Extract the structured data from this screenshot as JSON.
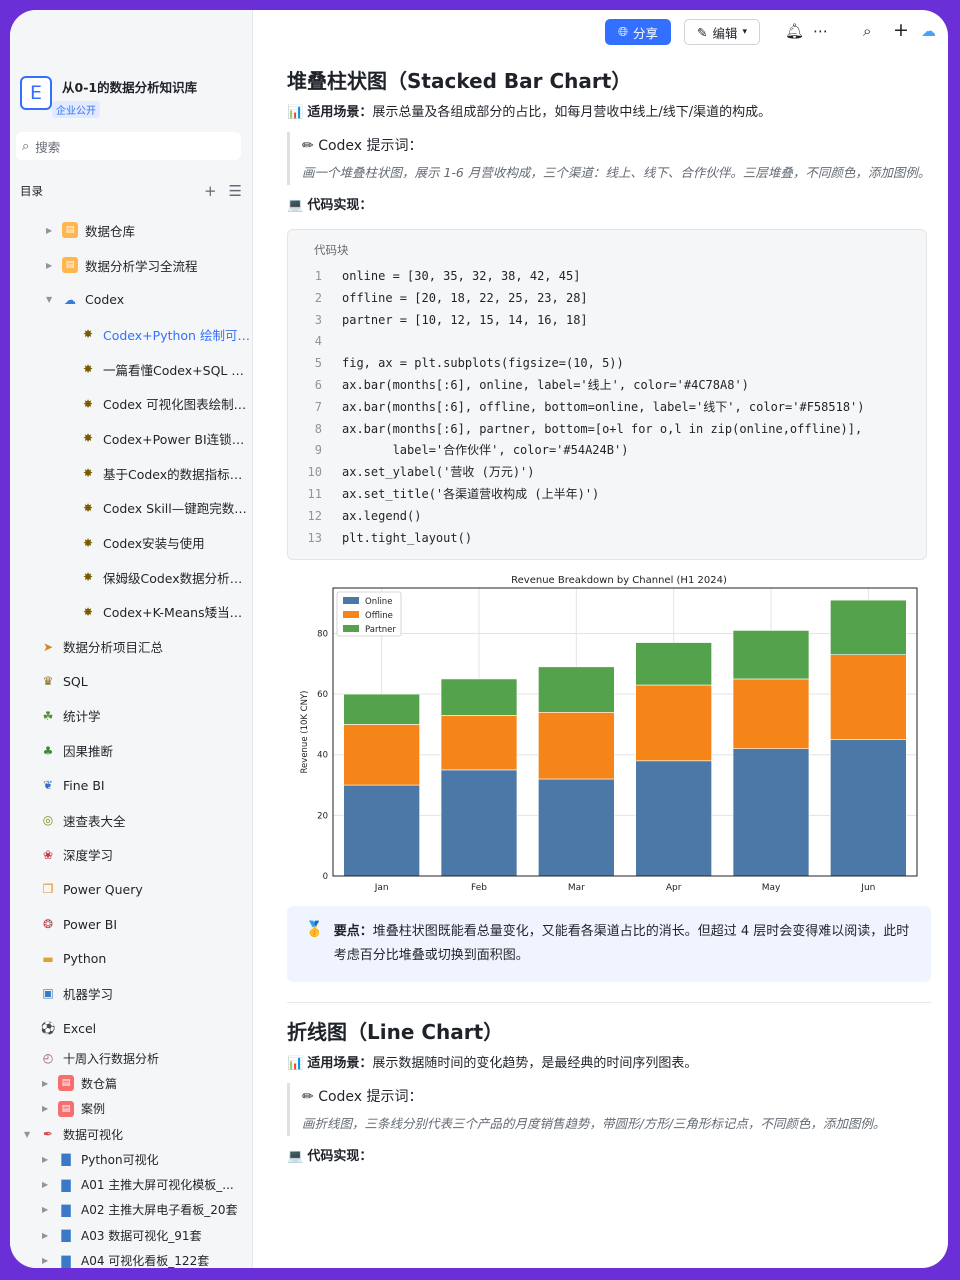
{
  "kb": {
    "logo_letter": "E",
    "title": "从0-1的数据分析知识库",
    "tag": "企业公开"
  },
  "search": {
    "placeholder": "搜索"
  },
  "toc_label": "目录",
  "toc": [
    {
      "label": "数据仓库",
      "icon": "folder-icon",
      "indent": 1,
      "arrow": "right"
    },
    {
      "label": "数据分析学习全流程",
      "icon": "folder-icon",
      "indent": 1,
      "arrow": "right"
    },
    {
      "label": "Codex",
      "icon": "codex-icon",
      "indent": 1,
      "arrow": "down"
    },
    {
      "label": "Codex+Python 绘制可视...",
      "icon": "sparkle-icon",
      "indent": 2,
      "active": true
    },
    {
      "label": "一篇看懂Codex+SQL 实操...",
      "icon": "sparkle-icon",
      "indent": 2
    },
    {
      "label": "Codex 可视化图表绘制全...",
      "icon": "sparkle-icon",
      "indent": 2
    },
    {
      "label": "Codex+Power BI连锁糕点...",
      "icon": "sparkle-icon",
      "indent": 2
    },
    {
      "label": "基于Codex的数据指标体...",
      "icon": "sparkle-icon",
      "indent": 2
    },
    {
      "label": "Codex Skill—键跑完数据...",
      "icon": "sparkle-icon",
      "indent": 2
    },
    {
      "label": "Codex安装与使用",
      "icon": "sparkle-icon",
      "indent": 2
    },
    {
      "label": "保姆级Codex数据分析技...",
      "icon": "sparkle-icon",
      "indent": 2
    },
    {
      "label": "Codex+K-Means矮当劳满...",
      "icon": "sparkle-icon",
      "indent": 2
    },
    {
      "label": "数据分析项目汇总",
      "icon": "rocket-icon",
      "indent": 0
    },
    {
      "label": "SQL",
      "icon": "crown-icon",
      "indent": 0
    },
    {
      "label": "统计学",
      "icon": "sprout-icon",
      "indent": 0
    },
    {
      "label": "因果推断",
      "icon": "tree-icon",
      "indent": 0
    },
    {
      "label": "Fine BI",
      "icon": "ribbon-icon",
      "indent": 0
    },
    {
      "label": "速查表大全",
      "icon": "snail-icon",
      "indent": 0
    },
    {
      "label": "深度学习",
      "icon": "butterfly-icon",
      "indent": 0
    },
    {
      "label": "Power Query",
      "icon": "gift-icon",
      "indent": 0
    },
    {
      "label": "Power BI",
      "icon": "medal-icon",
      "indent": 0
    },
    {
      "label": "Python",
      "icon": "box-icon",
      "indent": 0
    },
    {
      "label": "机器学习",
      "icon": "monitor-icon",
      "indent": 0
    },
    {
      "label": "Excel",
      "icon": "soccer-icon",
      "indent": 0
    },
    {
      "label": "十周入行数据分析",
      "icon": "clock-icon",
      "indent": 0,
      "small": true
    },
    {
      "label": "数仓篇",
      "icon": "red-folder-icon",
      "indent": 1,
      "arrow": "right",
      "small": true
    },
    {
      "label": "案例",
      "icon": "red-folder-icon",
      "indent": 1,
      "arrow": "right",
      "small": true
    },
    {
      "label": "数据可视化",
      "icon": "pin-icon",
      "indent": 0,
      "arrow": "down",
      "small": true
    },
    {
      "label": "Python可视化",
      "icon": "barchart-icon",
      "indent": 1,
      "arrow": "right",
      "small": true
    },
    {
      "label": "A01 主推大屏可视化模板_...",
      "icon": "barchart-icon",
      "indent": 1,
      "arrow": "right",
      "small": true
    },
    {
      "label": "A02 主推大屏电子看板_20套",
      "icon": "barchart-icon",
      "indent": 1,
      "arrow": "right",
      "small": true
    },
    {
      "label": "A03 数据可视化_91套",
      "icon": "barchart-icon",
      "indent": 1,
      "arrow": "right",
      "small": true
    },
    {
      "label": "A04 可视化看板_122套",
      "icon": "barchart-icon",
      "indent": 1,
      "arrow": "right",
      "small": true
    }
  ],
  "topbar": {
    "share": "分享",
    "edit": "编辑"
  },
  "section1": {
    "title": "堆叠柱状图（Stacked Bar Chart）",
    "scene_label": "适用场景：",
    "scene_text": "展示总量及各组成部分的占比，如每月营收中线上/线下/渠道的构成。",
    "prompt_label": "Codex 提示词：",
    "prompt_text": "画一个堆叠柱状图，展示 1-6 月营收构成，三个渠道：线上、线下、合作伙伴。三层堆叠，不同颜色，添加图例。",
    "code_label": "代码实现：",
    "code_header": "代码块",
    "code": [
      "online = [30, 35, 32, 38, 42, 45]",
      "offline = [20, 18, 22, 25, 23, 28]",
      "partner = [10, 12, 15, 14, 16, 18]",
      "",
      "fig, ax = plt.subplots(figsize=(10, 5))",
      "ax.bar(months[:6], online, label='线上', color='#4C78A8')",
      "ax.bar(months[:6], offline, bottom=online, label='线下', color='#F58518')",
      "ax.bar(months[:6], partner, bottom=[o+l for o,l in zip(online,offline)],",
      "       label='合作伙伴', color='#54A24B')",
      "ax.set_ylabel('营收 (万元)')",
      "ax.set_title('各渠道营收构成 (上半年)')",
      "ax.legend()",
      "plt.tight_layout()"
    ],
    "tip_label": "要点：",
    "tip_text": "堆叠柱状图既能看总量变化，又能看各渠道占比的消长。但超过 4 层时会变得难以阅读，此时考虑百分比堆叠或切换到面积图。"
  },
  "section2": {
    "title": "折线图（Line Chart）",
    "scene_label": "适用场景：",
    "scene_text": "展示数据随时间的变化趋势，是最经典的时间序列图表。",
    "prompt_label": "Codex 提示词：",
    "prompt_text": "画折线图，三条线分别代表三个产品的月度销售趋势，带圆形/方形/三角形标记点，不同颜色，添加图例。",
    "code_label": "代码实现："
  },
  "chart_data": {
    "type": "bar",
    "stacked": true,
    "title": "Revenue Breakdown by Channel (H1 2024)",
    "xlabel": "",
    "ylabel": "Revenue (10K CNY)",
    "categories": [
      "Jan",
      "Feb",
      "Mar",
      "Apr",
      "May",
      "Jun"
    ],
    "series": [
      {
        "name": "Online",
        "values": [
          30,
          35,
          32,
          38,
          42,
          45
        ],
        "color": "#4C78A8"
      },
      {
        "name": "Offline",
        "values": [
          20,
          18,
          22,
          25,
          23,
          28
        ],
        "color": "#F58518"
      },
      {
        "name": "Partner",
        "values": [
          10,
          12,
          15,
          14,
          16,
          18
        ],
        "color": "#54A24B"
      }
    ],
    "ylim": [
      0,
      95
    ],
    "yticks": [
      0,
      20,
      40,
      60,
      80
    ],
    "grid": true,
    "legend": "top-left"
  }
}
